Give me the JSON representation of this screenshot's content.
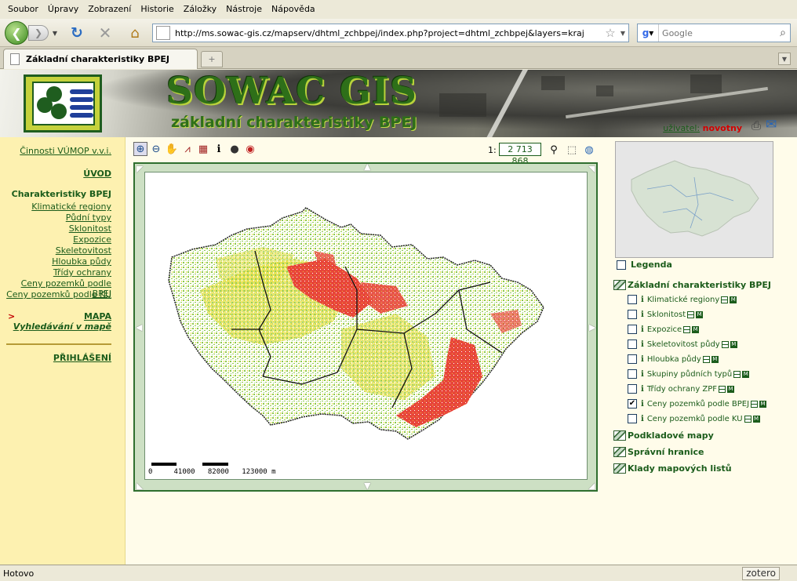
{
  "browser": {
    "menu": [
      "Soubor",
      "Úpravy",
      "Zobrazení",
      "Historie",
      "Záložky",
      "Nástroje",
      "Nápověda"
    ],
    "url": "http://ms.sowac-gis.cz/mapserv/dhtml_zchbpej/index.php?project=dhtml_zchbpej&layers=kraj",
    "search_placeholder": "Google",
    "tab_title": "Základní charakteristiky BPEJ",
    "new_tab_icon": "+",
    "status": "Hotovo",
    "zotero_label": "zotero"
  },
  "header": {
    "title": "SOWAC GIS",
    "subtitle": "základní charakteristiky BPEJ",
    "user_label": "uživatel:",
    "user_name": "novotny"
  },
  "leftmenu": {
    "org_link": "Činnosti VÚMOP v.v.i.",
    "uvod": "ÚVOD",
    "heading": "Charakteristiky BPEJ",
    "items": [
      "Klimatické regiony",
      "Půdní typy",
      "Sklonitost",
      "Expozice",
      "Skeletovitost",
      "Hloubka půdy",
      "Třídy ochrany",
      "Ceny pozemků podle BPEJ",
      "Ceny pozemků podle KU"
    ],
    "mapa": "MAPA",
    "vyhledavani": "Vyhledávání v mapě",
    "prihlaseni": "PŘIHLÁŠENÍ"
  },
  "map": {
    "scale_prefix": "1:",
    "scale_value": "2 713 868",
    "scalebar_labels": "0     41000   82000   123000 m"
  },
  "legend": {
    "legend_label": "Legenda",
    "groups": [
      "Základní charakteristiky BPEJ",
      "Podkladové mapy",
      "Správní hranice",
      "Klady mapových listů"
    ],
    "layers": [
      {
        "label": "Klimatické regiony",
        "checked": false
      },
      {
        "label": "Sklonitost",
        "checked": false
      },
      {
        "label": "Expozice",
        "checked": false
      },
      {
        "label": "Skeletovitost půdy",
        "checked": false
      },
      {
        "label": "Hloubka půdy",
        "checked": false
      },
      {
        "label": "Skupiny půdních typů",
        "checked": false
      },
      {
        "label": "Třídy ochrany ZPF",
        "checked": false
      },
      {
        "label": "Ceny pozemků podle BPEJ",
        "checked": true
      },
      {
        "label": "Ceny pozemků podle KU",
        "checked": false
      }
    ],
    "check_mark": "✔",
    "info_letter": "i",
    "meta_letter": "M"
  },
  "colors": {
    "accent_green": "#1b5c1b",
    "menu_bg": "#fdf1b0",
    "map_red": "#e8463a",
    "map_yellow": "#e6e14a",
    "map_green": "#8cc84a"
  }
}
